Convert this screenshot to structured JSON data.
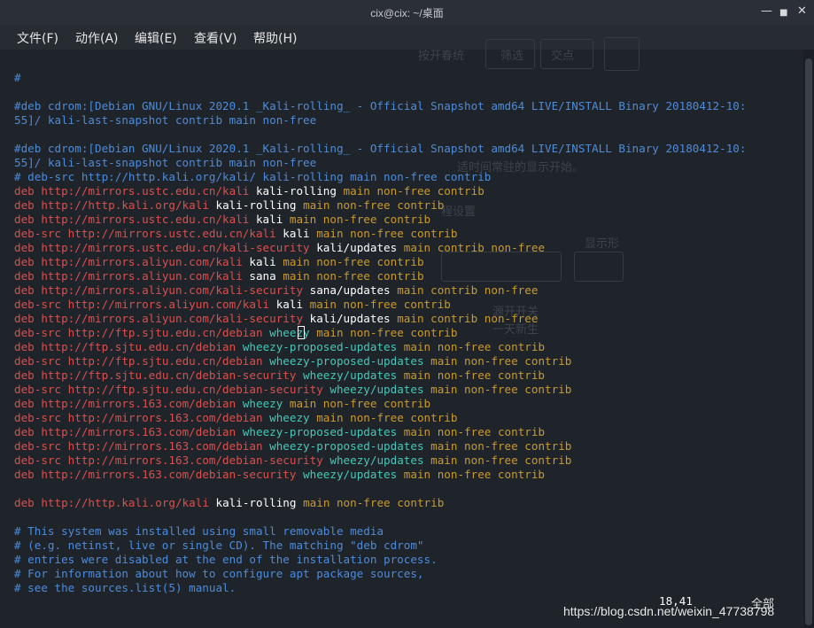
{
  "window": {
    "title": "cix@cix: ~/桌面"
  },
  "window_controls": {
    "minimize": "—",
    "maximize": "■",
    "close": "✕"
  },
  "menu": [
    {
      "label": "文件(F)"
    },
    {
      "label": "动作(A)"
    },
    {
      "label": "编辑(E)"
    },
    {
      "label": "查看(V)"
    },
    {
      "label": "帮助(H)"
    }
  ],
  "background_ghost": {
    "items": [
      "按开春统",
      "筛选",
      "交点",
      "适时间常驻的显示开始。",
      "程设置",
      "显示形",
      "源开开关",
      "一天新生"
    ]
  },
  "terminal": {
    "lines": [
      {
        "segments": [
          {
            "t": "#",
            "s": "c"
          }
        ]
      },
      {
        "segments": []
      },
      {
        "segments": [
          {
            "t": "#deb cdrom:[Debian GNU/Linux 2020.1 _Kali-rolling_ - Official Snapshot amd64 LIVE/INSTALL Binary 20180412-10:",
            "s": "c"
          }
        ]
      },
      {
        "segments": [
          {
            "t": "55]/ kali-last-snapshot contrib main non-free",
            "s": "c"
          }
        ]
      },
      {
        "segments": []
      },
      {
        "segments": [
          {
            "t": "#deb cdrom:[Debian GNU/Linux 2020.1 _Kali-rolling_ - Official Snapshot amd64 LIVE/INSTALL Binary 20180412-10:",
            "s": "c"
          }
        ]
      },
      {
        "segments": [
          {
            "t": "55]/ kali-last-snapshot contrib main non-free",
            "s": "c"
          }
        ]
      },
      {
        "segments": [
          {
            "t": "# deb-src http://http.kali.org/kali/ kali-rolling main non-free contrib",
            "s": "c"
          }
        ]
      },
      {
        "segments": [
          {
            "t": "deb ",
            "s": "k"
          },
          {
            "t": "http://mirrors.ustc.edu.cn/kali",
            "s": "u"
          },
          {
            "t": " kali-rolling",
            "s": "d"
          },
          {
            "t": " main non-free contrib",
            "s": "o"
          }
        ]
      },
      {
        "segments": [
          {
            "t": "deb ",
            "s": "k"
          },
          {
            "t": "http://http.kali.org/kali",
            "s": "u"
          },
          {
            "t": " kali-rolling",
            "s": "d"
          },
          {
            "t": " main non-free contrib",
            "s": "o"
          }
        ]
      },
      {
        "segments": [
          {
            "t": "deb ",
            "s": "k"
          },
          {
            "t": "http://mirrors.ustc.edu.cn/kali",
            "s": "u"
          },
          {
            "t": " kali",
            "s": "d"
          },
          {
            "t": " main non-free contrib",
            "s": "o"
          }
        ]
      },
      {
        "segments": [
          {
            "t": "deb-src ",
            "s": "k"
          },
          {
            "t": "http://mirrors.ustc.edu.cn/kali",
            "s": "u"
          },
          {
            "t": " kali",
            "s": "d"
          },
          {
            "t": " main non-free contrib",
            "s": "o"
          }
        ]
      },
      {
        "segments": [
          {
            "t": "deb ",
            "s": "k"
          },
          {
            "t": "http://mirrors.ustc.edu.cn/kali-security",
            "s": "u"
          },
          {
            "t": " kali/updates",
            "s": "d"
          },
          {
            "t": " main contrib non-free",
            "s": "o"
          }
        ]
      },
      {
        "segments": [
          {
            "t": "deb ",
            "s": "k"
          },
          {
            "t": "http://mirrors.aliyun.com/kali",
            "s": "u"
          },
          {
            "t": " kali",
            "s": "d"
          },
          {
            "t": " main non-free contrib",
            "s": "o"
          }
        ]
      },
      {
        "segments": [
          {
            "t": "deb ",
            "s": "k"
          },
          {
            "t": "http://mirrors.aliyun.com/kali",
            "s": "u"
          },
          {
            "t": " sana",
            "s": "d"
          },
          {
            "t": " main non-free contrib",
            "s": "o"
          }
        ]
      },
      {
        "segments": [
          {
            "t": "deb ",
            "s": "k"
          },
          {
            "t": "http://mirrors.aliyun.com/kali-security",
            "s": "u"
          },
          {
            "t": " sana/updates",
            "s": "d"
          },
          {
            "t": " main contrib non-free",
            "s": "o"
          }
        ]
      },
      {
        "segments": [
          {
            "t": "deb-src ",
            "s": "k"
          },
          {
            "t": "http://mirrors.aliyun.com/kali",
            "s": "u"
          },
          {
            "t": " kali",
            "s": "d"
          },
          {
            "t": " main non-free contrib",
            "s": "o"
          }
        ]
      },
      {
        "segments": [
          {
            "t": "deb ",
            "s": "k"
          },
          {
            "t": "http://mirrors.aliyun.com/kali-security",
            "s": "u"
          },
          {
            "t": " kali/updates",
            "s": "d"
          },
          {
            "t": " main contrib non-free",
            "s": "o"
          }
        ]
      },
      {
        "segments": [
          {
            "t": "deb-src ",
            "s": "k"
          },
          {
            "t": "http://ftp.sjtu.edu.cn/debian",
            "s": "u"
          },
          {
            "t": " wheezy",
            "s": "dc"
          },
          {
            "t": " main non-free contrib",
            "s": "o"
          }
        ]
      },
      {
        "segments": [
          {
            "t": "deb ",
            "s": "k"
          },
          {
            "t": "http://ftp.sjtu.edu.cn/debian",
            "s": "u"
          },
          {
            "t": " wheezy-proposed-updates",
            "s": "dc"
          },
          {
            "t": " main non-free contrib",
            "s": "o"
          }
        ]
      },
      {
        "segments": [
          {
            "t": "deb-src ",
            "s": "k"
          },
          {
            "t": "http://ftp.sjtu.edu.cn/debian",
            "s": "u"
          },
          {
            "t": " wheezy-proposed-updates",
            "s": "dc"
          },
          {
            "t": " main non-free contrib",
            "s": "o"
          }
        ]
      },
      {
        "segments": [
          {
            "t": "deb ",
            "s": "k"
          },
          {
            "t": "http://ftp.sjtu.edu.cn/debian-security",
            "s": "u"
          },
          {
            "t": " wheezy/updates",
            "s": "dc"
          },
          {
            "t": " main non-free contrib",
            "s": "o"
          }
        ]
      },
      {
        "segments": [
          {
            "t": "deb-src ",
            "s": "k"
          },
          {
            "t": "http://ftp.sjtu.edu.cn/debian-security",
            "s": "u"
          },
          {
            "t": " wheezy/updates",
            "s": "dc"
          },
          {
            "t": " main non-free contrib",
            "s": "o"
          }
        ]
      },
      {
        "segments": [
          {
            "t": "deb ",
            "s": "k"
          },
          {
            "t": "http://mirrors.163.com/debian",
            "s": "u"
          },
          {
            "t": " wheezy",
            "s": "dc"
          },
          {
            "t": " main non-free contrib",
            "s": "o"
          }
        ]
      },
      {
        "segments": [
          {
            "t": "deb-src ",
            "s": "k"
          },
          {
            "t": "http://mirrors.163.com/debian",
            "s": "u"
          },
          {
            "t": " wheezy",
            "s": "dc"
          },
          {
            "t": " main non-free contrib",
            "s": "o"
          }
        ]
      },
      {
        "segments": [
          {
            "t": "deb ",
            "s": "k"
          },
          {
            "t": "http://mirrors.163.com/debian",
            "s": "u"
          },
          {
            "t": " wheezy-proposed-updates",
            "s": "dc"
          },
          {
            "t": " main non-free contrib",
            "s": "o"
          }
        ]
      },
      {
        "segments": [
          {
            "t": "deb-src ",
            "s": "k"
          },
          {
            "t": "http://mirrors.163.com/debian",
            "s": "u"
          },
          {
            "t": " wheezy-proposed-updates",
            "s": "dc"
          },
          {
            "t": " main non-free contrib",
            "s": "o"
          }
        ]
      },
      {
        "segments": [
          {
            "t": "deb-src ",
            "s": "k"
          },
          {
            "t": "http://mirrors.163.com/debian-security",
            "s": "u"
          },
          {
            "t": " wheezy/updates",
            "s": "dc"
          },
          {
            "t": " main non-free contrib",
            "s": "o"
          }
        ]
      },
      {
        "segments": [
          {
            "t": "deb ",
            "s": "k"
          },
          {
            "t": "http://mirrors.163.com/debian-security",
            "s": "u"
          },
          {
            "t": " wheezy/updates",
            "s": "dc"
          },
          {
            "t": " main non-free contrib",
            "s": "o"
          }
        ]
      },
      {
        "segments": []
      },
      {
        "segments": [
          {
            "t": "deb ",
            "s": "k"
          },
          {
            "t": "http://http.kali.org/kali",
            "s": "u"
          },
          {
            "t": " kali-rolling",
            "s": "d"
          },
          {
            "t": " main non-free contrib",
            "s": "o"
          }
        ]
      },
      {
        "segments": []
      },
      {
        "segments": [
          {
            "t": "# This system was installed using small removable media",
            "s": "c"
          }
        ]
      },
      {
        "segments": [
          {
            "t": "# (e.g. netinst, live or single CD). The matching \"deb cdrom\"",
            "s": "c"
          }
        ]
      },
      {
        "segments": [
          {
            "t": "# entries were disabled at the end of the installation process.",
            "s": "c"
          }
        ]
      },
      {
        "segments": [
          {
            "t": "# For information about how to configure apt package sources,",
            "s": "c"
          }
        ]
      },
      {
        "segments": [
          {
            "t": "# see the sources.list(5) manual.",
            "s": "c"
          }
        ]
      }
    ]
  },
  "status": {
    "position": "18,41",
    "scope": "全部"
  },
  "watermark": "https://blog.csdn.net/weixin_47738798",
  "colors": {
    "comment": "#4d8bd9",
    "keyword": "#d9504d",
    "distribution": "#ffffff",
    "debian_dist": "#47c7b8",
    "components": "#c99a2e"
  }
}
